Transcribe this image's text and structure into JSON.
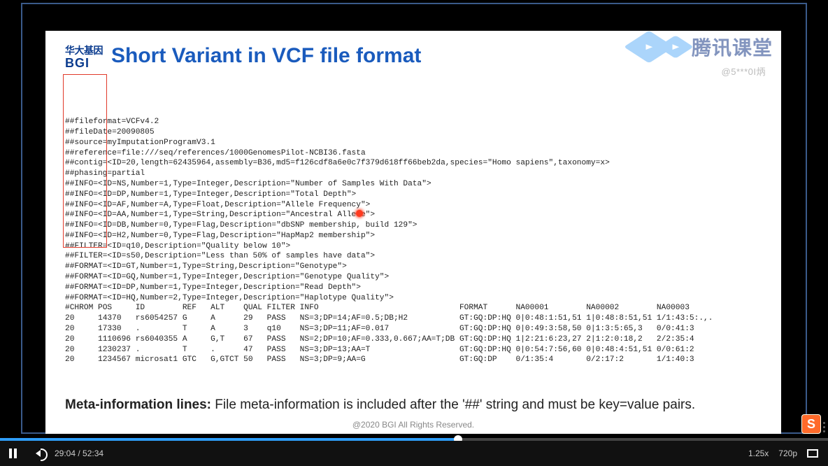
{
  "watermark": {
    "brand_cn": "腾讯课堂",
    "small_text": "@5***0I炳"
  },
  "slide": {
    "logo_cn": "华大基因",
    "logo_en": "BGI",
    "title": "Short Variant in VCF file format",
    "vcf_header_lines": [
      "##fileformat=VCFv4.2",
      "##fileDate=20090805",
      "##source=myImputationProgramV3.1",
      "##reference=file:///seq/references/1000GenomesPilot-NCBI36.fasta",
      "##contig=<ID=20,length=62435964,assembly=B36,md5=f126cdf8a6e0c7f379d618ff66beb2da,species=\"Homo sapiens\",taxonomy=x>",
      "##phasing=partial",
      "##INFO=<ID=NS,Number=1,Type=Integer,Description=\"Number of Samples With Data\">",
      "##INFO=<ID=DP,Number=1,Type=Integer,Description=\"Total Depth\">",
      "##INFO=<ID=AF,Number=A,Type=Float,Description=\"Allele Frequency\">",
      "##INFO=<ID=AA,Number=1,Type=String,Description=\"Ancestral Allele\">",
      "##INFO=<ID=DB,Number=0,Type=Flag,Description=\"dbSNP membership, build 129\">",
      "##INFO=<ID=H2,Number=0,Type=Flag,Description=\"HapMap2 membership\">",
      "##FILTER=<ID=q10,Description=\"Quality below 10\">",
      "##FILTER=<ID=s50,Description=\"Less than 50% of samples have data\">",
      "##FORMAT=<ID=GT,Number=1,Type=String,Description=\"Genotype\">",
      "##FORMAT=<ID=GQ,Number=1,Type=Integer,Description=\"Genotype Quality\">",
      "##FORMAT=<ID=DP,Number=1,Type=Integer,Description=\"Read Depth\">",
      "##FORMAT=<ID=HQ,Number=2,Type=Integer,Description=\"Haplotype Quality\">"
    ],
    "vcf_table_header": "#CHROM POS     ID        REF   ALT    QUAL FILTER INFO                              FORMAT      NA00001        NA00002        NA00003",
    "vcf_table_rows": [
      "20     14370   rs6054257 G     A      29   PASS   NS=3;DP=14;AF=0.5;DB;H2           GT:GQ:DP:HQ 0|0:48:1:51,51 1|0:48:8:51,51 1/1:43:5:.,.",
      "20     17330   .         T     A      3    q10    NS=3;DP=11;AF=0.017               GT:GQ:DP:HQ 0|0:49:3:58,50 0|1:3:5:65,3   0/0:41:3",
      "20     1110696 rs6040355 A     G,T    67   PASS   NS=2;DP=10;AF=0.333,0.667;AA=T;DB GT:GQ:DP:HQ 1|2:21:6:23,27 2|1:2:0:18,2   2/2:35:4",
      "20     1230237 .         T     .      47   PASS   NS=3;DP=13;AA=T                   GT:GQ:DP:HQ 0|0:54:7:56,60 0|0:48:4:51,51 0/0:61:2",
      "20     1234567 microsat1 GTC   G,GTCT 50   PASS   NS=3;DP=9;AA=G                    GT:GQ:DP    0/1:35:4       0/2:17:2       1/1:40:3"
    ],
    "note_bold": "Meta-information lines:",
    "note_text": " File meta-information is included after the '##' string and must be key=value pairs.",
    "footer": "@2020 BGI All Rights Reserved."
  },
  "player": {
    "current_time": "29:04",
    "total_time": "52:34",
    "separator": " / ",
    "speed": "1.25x",
    "quality": "720p"
  },
  "sogou_badge": "S"
}
